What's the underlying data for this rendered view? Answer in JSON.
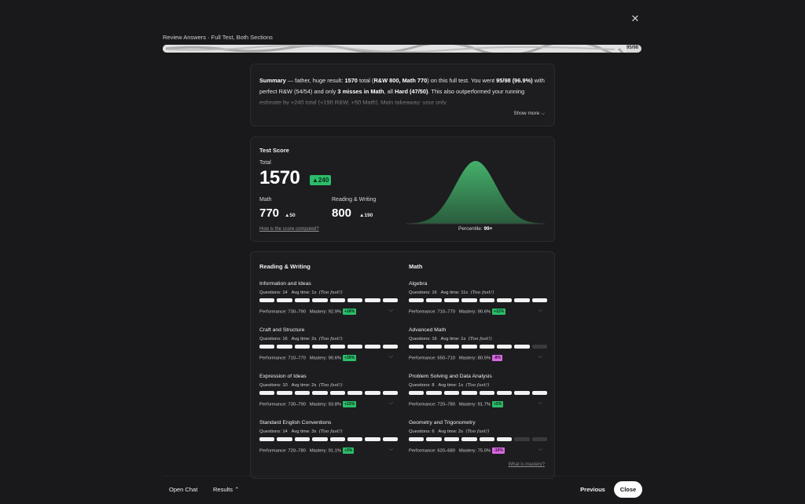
{
  "header": {
    "title": "Review Answers · Full Test, Both Sections",
    "progress_count": "95/98",
    "progress_fraction": 0.969,
    "close_icon": "close-icon"
  },
  "summary": {
    "label": "Summary",
    "t1": " — father, huge result: ",
    "b1": "1570",
    "t2": " total (",
    "b2": "R&W 800, Math 770",
    "t3": ") on this full test. You went ",
    "b3": "95/98 (96.9%)",
    "t4": " with perfect R&W (54/54) and only ",
    "b4": "3 misses in Math",
    "t5": ", all ",
    "b5": "Hard (47/50)",
    "t6": ". This also outperformed your running estimate by +240 total (+190 R&W, +50 Math). Main takeaway: your only",
    "show_more": "Show more ⌵"
  },
  "score": {
    "section_title": "Test Score",
    "total_label": "Total",
    "total": "1570",
    "total_delta": "▲240",
    "math_label": "Math",
    "math_score": "770",
    "math_delta": "▲50",
    "rw_label": "Reading & Writing",
    "rw_score": "800",
    "rw_delta": "▲190",
    "how_link": "How is the score computed?",
    "percentile_label": "Percentile:",
    "percentile_value": "99+",
    "curve_color": "#3fa865"
  },
  "skills": {
    "rw_title": "Reading & Writing",
    "math_title": "Math",
    "too_fast": "(Too fast!)",
    "what_mastery": "What is mastery?",
    "rw_items": [
      {
        "name": "Information and Ideas",
        "questions": "Questions: 14",
        "avg": "Avg time: 1s",
        "perf": "Performance: 730–790",
        "mastery": "Mastery: 92.9%",
        "delta": "+18%",
        "dir": "up",
        "filled": 8
      },
      {
        "name": "Craft and Structure",
        "questions": "Questions: 16",
        "avg": "Avg time: 2s",
        "perf": "Performance: 710–770",
        "mastery": "Mastery: 90.6%",
        "delta": "+39%",
        "dir": "up",
        "filled": 8
      },
      {
        "name": "Expression of Ideas",
        "questions": "Questions: 10",
        "avg": "Avg time: 2s",
        "perf": "Performance: 730–790",
        "mastery": "Mastery: 93.8%",
        "delta": "+23%",
        "dir": "up",
        "filled": 8
      },
      {
        "name": "Standard English Conventions",
        "questions": "Questions: 14",
        "avg": "Avg time: 3s",
        "perf": "Performance: 720–780",
        "mastery": "Mastery: 91.1%",
        "delta": "+3%",
        "dir": "up",
        "filled": 8
      }
    ],
    "math_items": [
      {
        "name": "Algebra",
        "questions": "Questions: 16",
        "avg": "Avg time: 11s",
        "perf": "Performance: 710–770",
        "mastery": "Mastery: 90.6%",
        "delta": "+11%",
        "dir": "up",
        "filled": 8
      },
      {
        "name": "Advanced Math",
        "questions": "Questions: 16",
        "avg": "Avg time: 1s",
        "perf": "Performance: 650–710",
        "mastery": "Mastery: 80.5%",
        "delta": "-8%",
        "dir": "down",
        "filled": 7
      },
      {
        "name": "Problem Solving and Data Analysis",
        "questions": "Questions: 8",
        "avg": "Avg time: 1s",
        "perf": "Performance: 720–780",
        "mastery": "Mastery: 91.7%",
        "delta": "+5%",
        "dir": "up",
        "filled": 8
      },
      {
        "name": "Geometry and Trigonometry",
        "questions": "Questions: 6",
        "avg": "Avg time: 2s",
        "perf": "Performance: 620–680",
        "mastery": "Mastery: 75.0%",
        "delta": "-10%",
        "dir": "down",
        "filled": 6
      }
    ]
  },
  "footer": {
    "open_chat": "Open Chat",
    "results": "Results ⌃",
    "previous": "Previous",
    "close": "Close"
  }
}
